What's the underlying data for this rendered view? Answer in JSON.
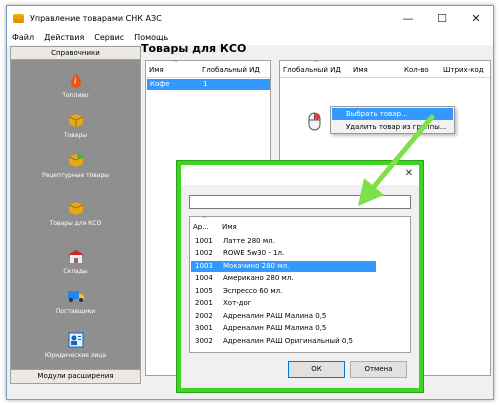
{
  "window": {
    "title": "Управление товарами СНК АЗС",
    "controls": {
      "minimize": "—",
      "maximize": "☐",
      "close": "✕"
    }
  },
  "menu": [
    "Файл",
    "Действия",
    "Сервис",
    "Помощь"
  ],
  "sidebar": {
    "header": "Справочники",
    "items": [
      {
        "label": "Топливо",
        "icon": "fuel-drop-icon"
      },
      {
        "label": "Товары",
        "icon": "box-icon"
      },
      {
        "label": "Рецептурные товары",
        "icon": "recipe-box-icon"
      },
      {
        "label": "Товары для КСО",
        "icon": "kso-box-icon"
      },
      {
        "label": "Склады",
        "icon": "warehouse-icon"
      },
      {
        "label": "Поставщики",
        "icon": "truck-icon"
      },
      {
        "label": "Юридические лица",
        "icon": "legal-entity-icon"
      }
    ],
    "footer": "Модули расширения"
  },
  "main": {
    "title": "Товары для КСО",
    "left_grid": {
      "columns": [
        "Имя",
        "Глобальный ИД"
      ],
      "rows": [
        {
          "name": "Кофе",
          "id": "1"
        }
      ]
    },
    "right_grid": {
      "columns": [
        "Глобальный ИД",
        "Имя",
        "Кол-во",
        "Штрих-код"
      ]
    }
  },
  "context_menu": [
    "Выбрать товар...",
    "Удалить товар из группы..."
  ],
  "dialog": {
    "close": "✕",
    "search_value": "",
    "columns": [
      "Ар...",
      "Имя"
    ],
    "rows": [
      {
        "code": "1001",
        "name": "Латте 280 мл."
      },
      {
        "code": "1002",
        "name": "ROWE 5w30 - 1л."
      },
      {
        "code": "1003",
        "name": "Мокачино 280 мл."
      },
      {
        "code": "1004",
        "name": "Американо 280 мл."
      },
      {
        "code": "1005",
        "name": "Эспрессо 60 мл."
      },
      {
        "code": "2001",
        "name": "Хот-дог"
      },
      {
        "code": "2002",
        "name": "Адреналин РАШ Малина 0,5"
      },
      {
        "code": "3001",
        "name": "Адреналин РАШ Малина 0,5"
      },
      {
        "code": "3002",
        "name": "Адреналин РАШ Оригинальный 0,5"
      }
    ],
    "ok": "ОК",
    "cancel": "Отмена"
  },
  "colors": {
    "selection": "#3399ff",
    "highlight": "#3fd41f"
  }
}
